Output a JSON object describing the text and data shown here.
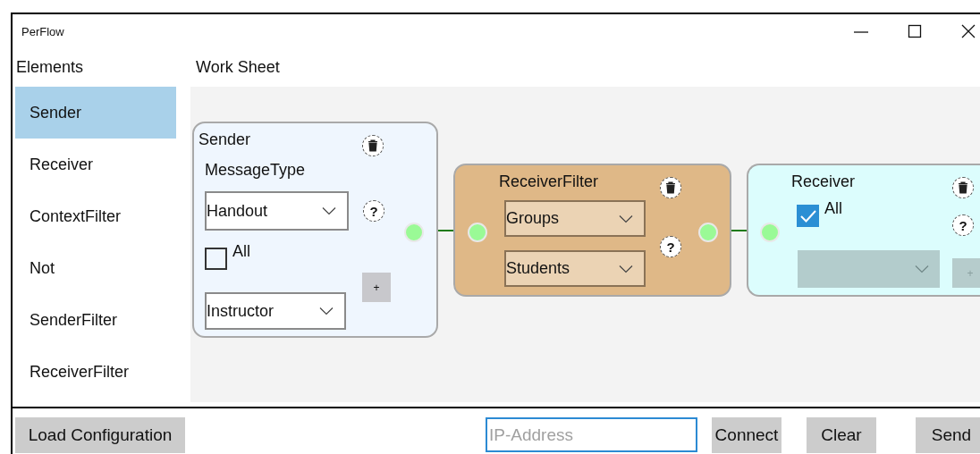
{
  "window": {
    "title": "PerFlow"
  },
  "sidebar": {
    "heading": "Elements",
    "items": [
      {
        "label": "Sender",
        "selected": true
      },
      {
        "label": "Receiver",
        "selected": false
      },
      {
        "label": "ContextFilter",
        "selected": false
      },
      {
        "label": "Not",
        "selected": false
      },
      {
        "label": "SenderFilter",
        "selected": false
      },
      {
        "label": "ReceiverFilter",
        "selected": false
      }
    ]
  },
  "worksheet": {
    "heading": "Work Sheet",
    "nodes": [
      {
        "kind": "sender",
        "title": "Sender",
        "label": "MessageType",
        "help": "?",
        "dropdowns": [
          {
            "value": "Handout",
            "disabled": false
          },
          {
            "value": "Instructor",
            "disabled": false
          }
        ],
        "checkbox": {
          "label": "All",
          "checked": false
        },
        "add_button": {
          "label": "+",
          "disabled": false
        }
      },
      {
        "kind": "filter",
        "title": "ReceiverFilter",
        "help": "?",
        "dropdowns": [
          {
            "value": "Groups",
            "disabled": false
          },
          {
            "value": "Students",
            "disabled": false
          }
        ]
      },
      {
        "kind": "receiver",
        "title": "Receiver",
        "help": "?",
        "dropdowns": [
          {
            "disabled": true
          }
        ],
        "checkbox": {
          "label": "All",
          "checked": true
        },
        "add_button": {
          "label": "+",
          "disabled": true
        }
      }
    ]
  },
  "bottom_bar": {
    "load_button": "Load Configuration",
    "address_field": {
      "placeholder": "IP-Address",
      "focused": true
    },
    "buttons": [
      "Connect",
      "Clear",
      "Send"
    ]
  }
}
